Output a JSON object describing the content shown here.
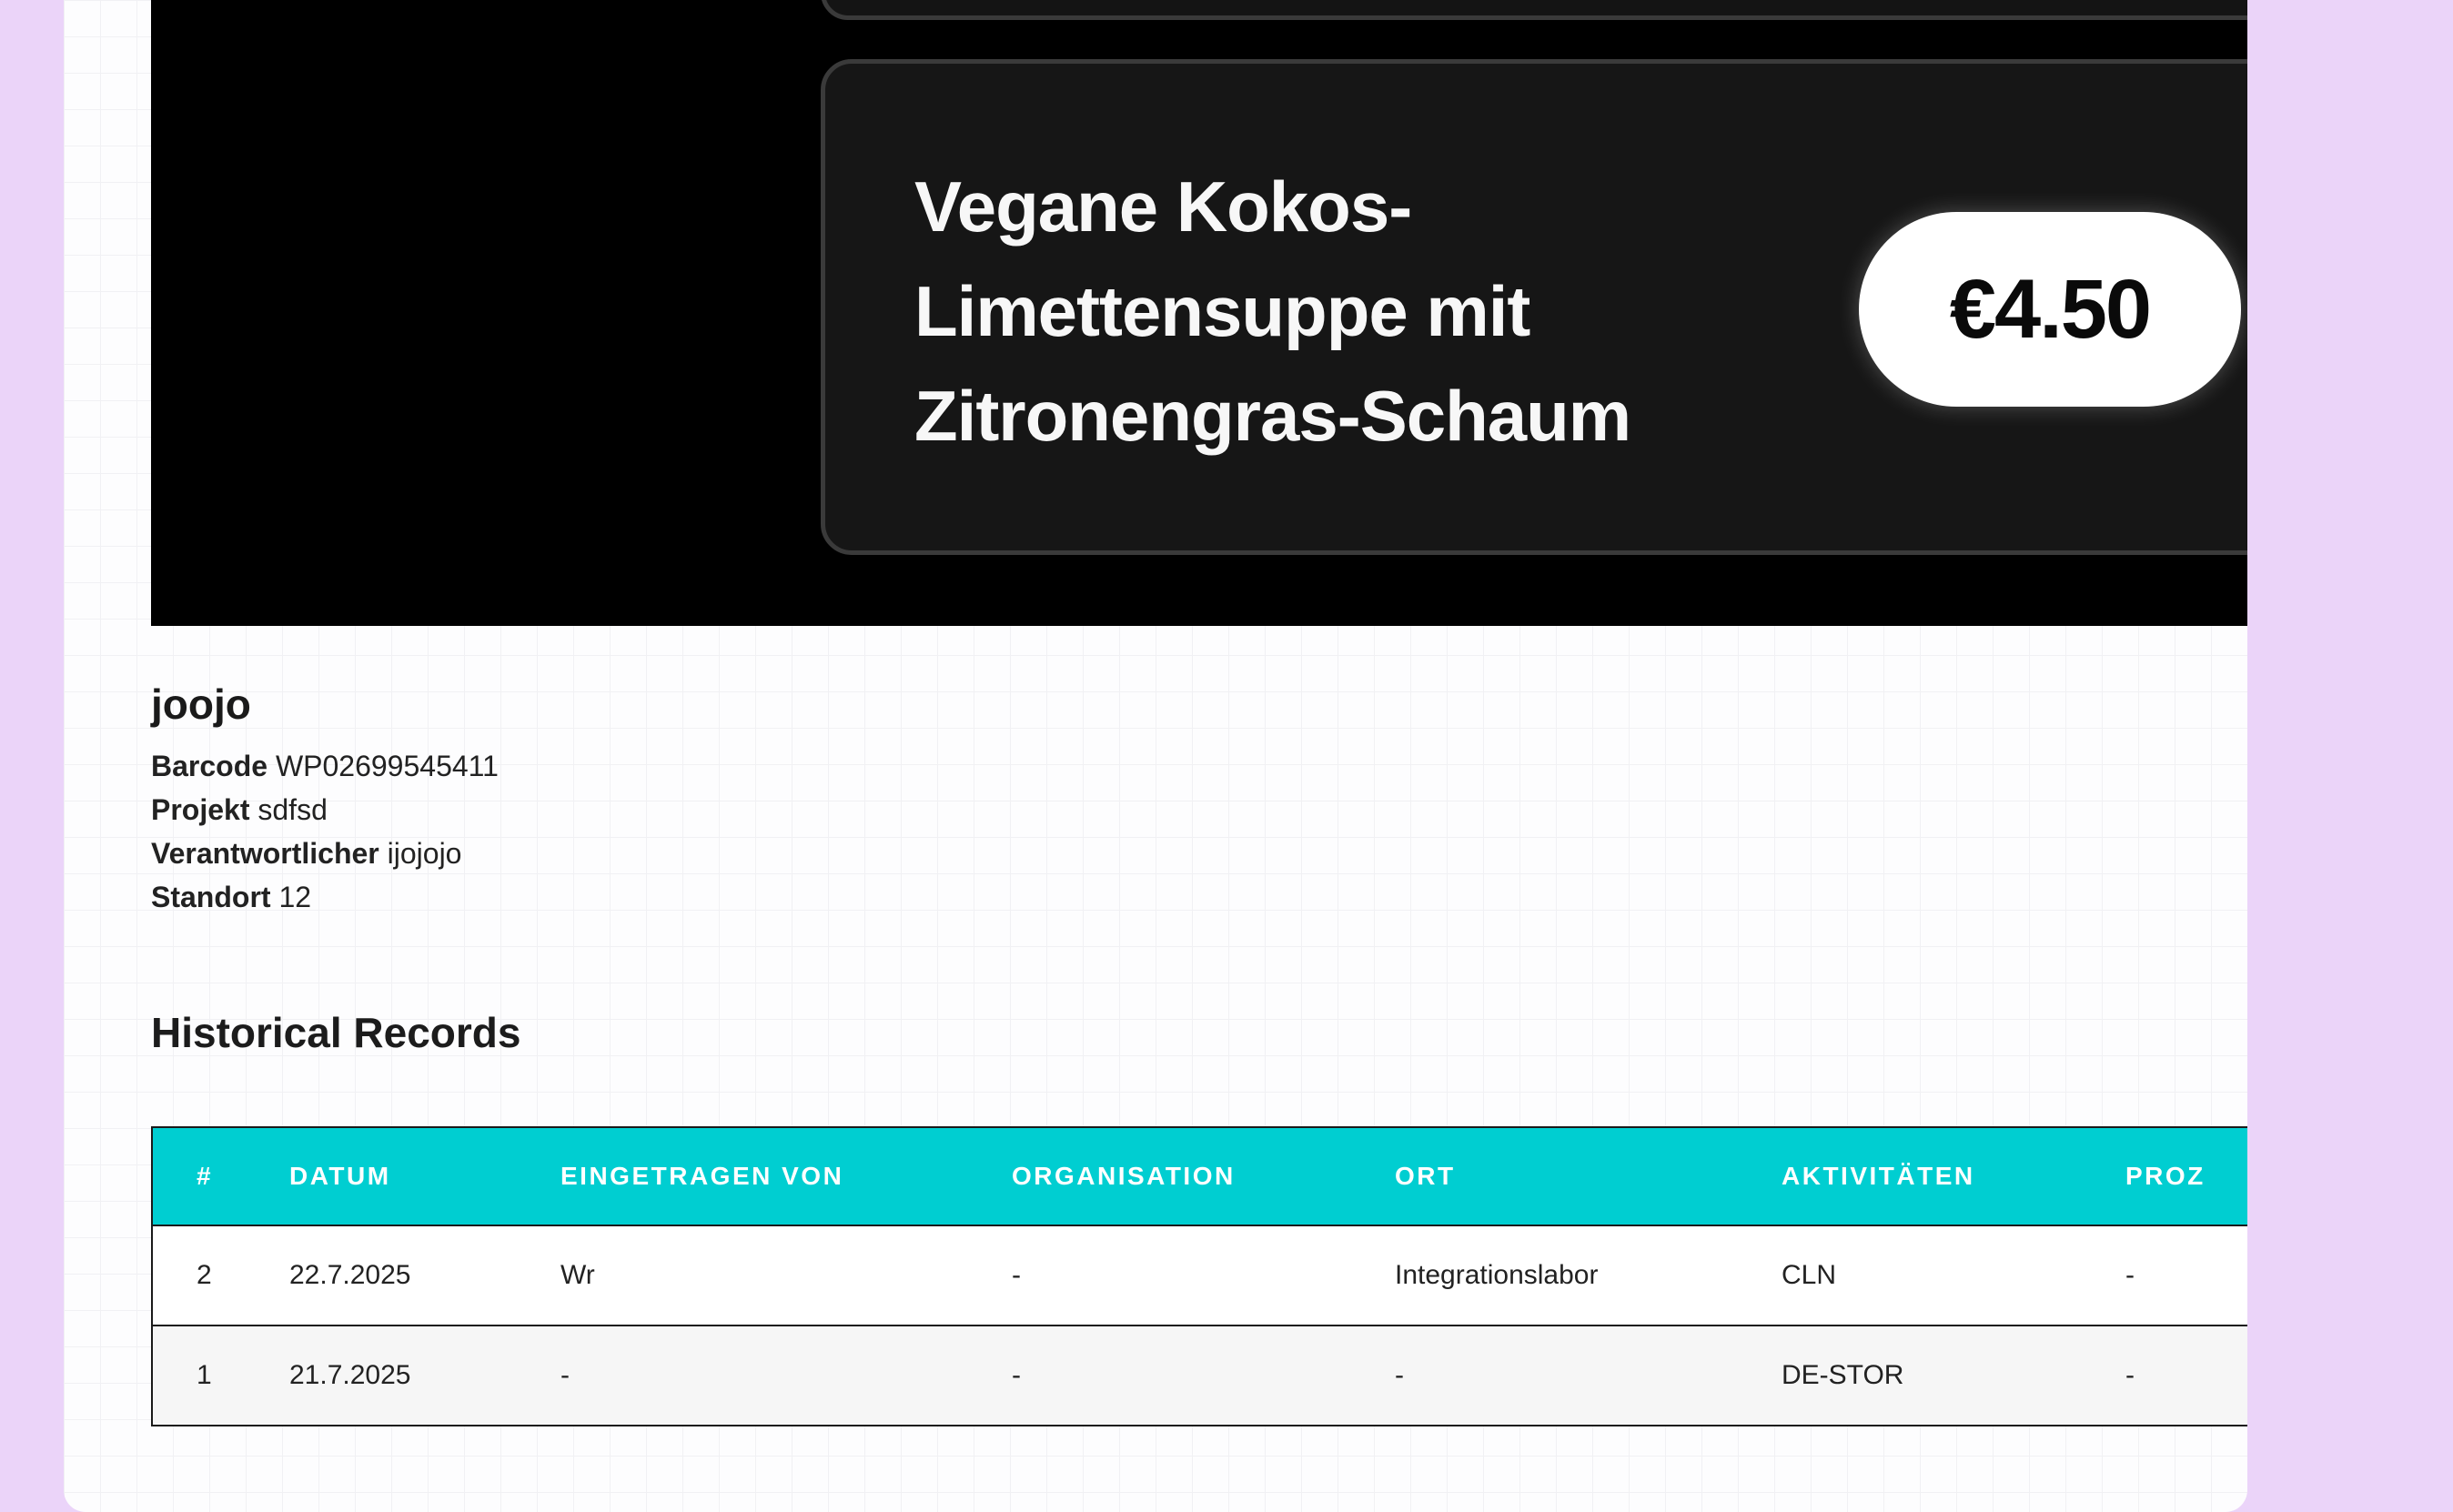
{
  "hero": {
    "menu_item_name_line1": "Vegane Kokos-",
    "menu_item_name_line2": "Limettensuppe mit",
    "menu_item_name_line3": "Zitronengras-Schaum",
    "price": "€4.50"
  },
  "item": {
    "title": "joojo",
    "fields": [
      {
        "label": "Barcode",
        "value": "WP02699545411"
      },
      {
        "label": "Projekt",
        "value": "sdfsd"
      },
      {
        "label": "Verantwortlicher",
        "value": "ijojojo"
      },
      {
        "label": "Standort",
        "value": "12"
      }
    ]
  },
  "history": {
    "title": "Historical Records",
    "columns": [
      "#",
      "DATUM",
      "EINGETRAGEN VON",
      "ORGANISATION",
      "ORT",
      "AKTIVITÄTEN",
      "PROZ"
    ],
    "rows": [
      [
        "2",
        "22.7.2025",
        "Wr",
        "-",
        "Integrationslabor",
        "CLN",
        "-"
      ],
      [
        "1",
        "21.7.2025",
        "-",
        "-",
        "-",
        "DE-STOR",
        "-"
      ]
    ]
  },
  "colors": {
    "background": "#ebd4f9",
    "table_header": "#00ced1",
    "hero_bg": "#000000"
  }
}
